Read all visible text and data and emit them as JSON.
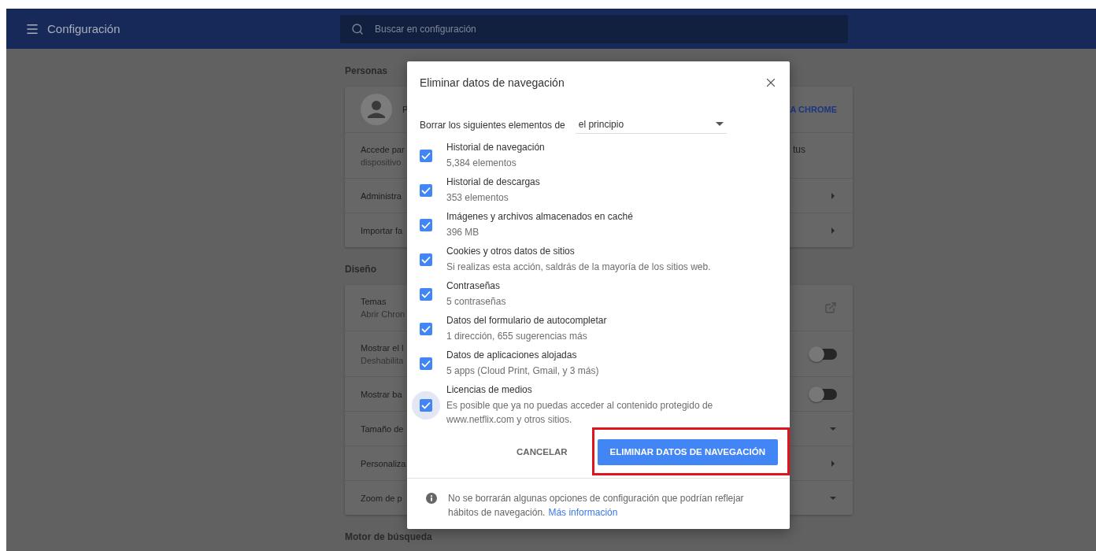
{
  "header": {
    "title": "Configuración",
    "search": {
      "placeholder": "Buscar en configuración"
    }
  },
  "sections": [
    {
      "title": "Personas",
      "rows": [
        {
          "kind": "profile",
          "lines": [
            "P"
          ],
          "trailing": "A CHROME"
        },
        {
          "kind": "text",
          "lines": [
            "Accede par",
            "dispositivo"
          ],
          "trailing": "tus"
        },
        {
          "kind": "arrow",
          "lines": [
            "Administra"
          ]
        },
        {
          "kind": "arrow",
          "lines": [
            "Importar fa"
          ]
        }
      ]
    },
    {
      "title": "Diseño",
      "rows": [
        {
          "kind": "external",
          "lines": [
            "Temas",
            "Abrir Chron"
          ]
        },
        {
          "kind": "toggle",
          "lines": [
            "Mostrar el l",
            "Deshabilita"
          ],
          "on": false
        },
        {
          "kind": "toggle",
          "lines": [
            "Mostrar ba"
          ],
          "on": false
        },
        {
          "kind": "dropdown",
          "lines": [
            "Tamaño de"
          ]
        },
        {
          "kind": "arrow",
          "lines": [
            "Personaliza"
          ]
        },
        {
          "kind": "dropdown",
          "lines": [
            "Zoom de p"
          ]
        }
      ]
    },
    {
      "title": "Motor de búsqueda"
    }
  ],
  "dialog": {
    "title": "Eliminar datos de navegación",
    "range": {
      "label": "Borrar los siguientes elementos de",
      "value": "el principio"
    },
    "items": [
      {
        "title": "Historial de navegación",
        "detail": "5,384 elementos",
        "checked": true,
        "focused": false
      },
      {
        "title": "Historial de descargas",
        "detail": "353 elementos",
        "checked": true,
        "focused": false
      },
      {
        "title": "Imágenes y archivos almacenados en caché",
        "detail": "396 MB",
        "checked": true,
        "focused": false
      },
      {
        "title": "Cookies y otros datos de sitios",
        "detail": "Si realizas esta acción, saldrás de la mayoría de los sitios web.",
        "checked": true,
        "focused": false
      },
      {
        "title": "Contraseñas",
        "detail": "5 contraseñas",
        "checked": true,
        "focused": false
      },
      {
        "title": "Datos del formulario de autocompletar",
        "detail": "1 dirección, 655 sugerencias más",
        "checked": true,
        "focused": false
      },
      {
        "title": "Datos de aplicaciones alojadas",
        "detail": "5 apps (Cloud Print, Gmail, y 3 más)",
        "checked": true,
        "focused": false
      },
      {
        "title": "Licencias de medios",
        "detail": "Es posible que ya no puedas acceder al contenido protegido de www.netflix.com y otros sitios.",
        "checked": true,
        "focused": true
      }
    ],
    "buttons": [
      {
        "kind": "text",
        "label": "CANCELAR",
        "highlighted": false
      },
      {
        "kind": "primary",
        "label": "ELIMINAR DATOS DE NAVEGACIÓN",
        "highlighted": true
      }
    ],
    "footer": {
      "text": "No se borrarán algunas opciones de configuración que podrían reflejar hábitos de navegación.",
      "link": "Más información"
    }
  }
}
